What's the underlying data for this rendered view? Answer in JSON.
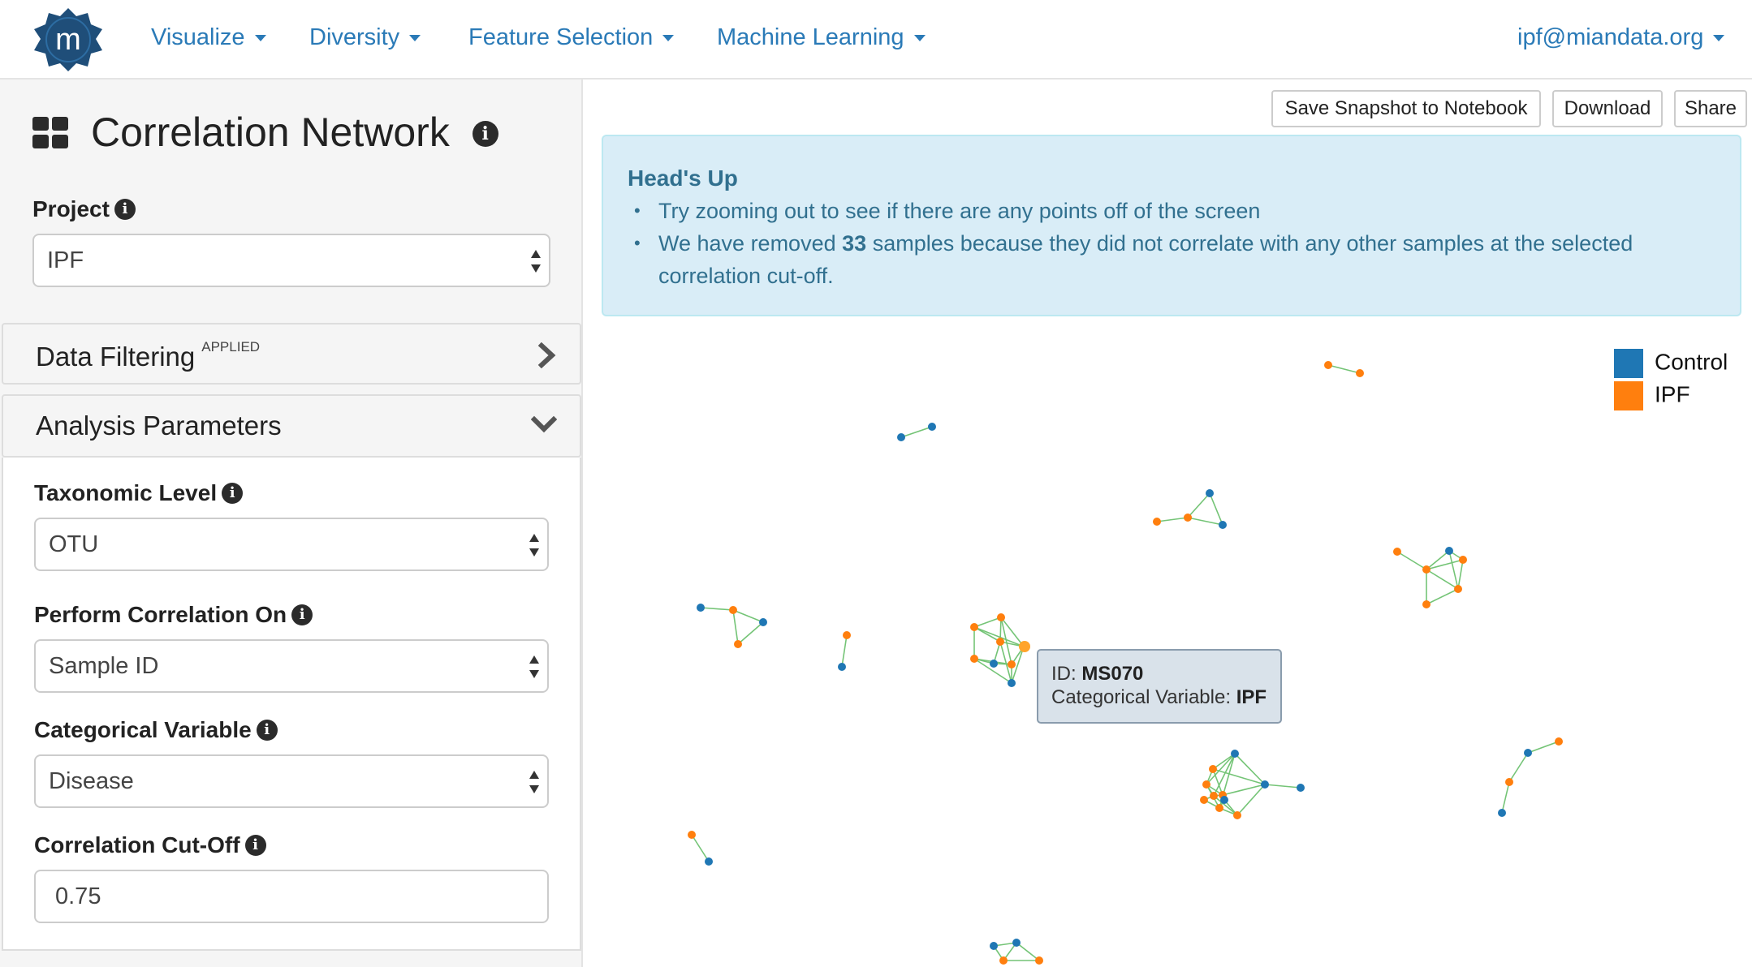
{
  "brand": {
    "logo_letter": "m",
    "logo_color": "#1f4e79"
  },
  "nav": {
    "items": [
      "Visualize",
      "Diversity",
      "Feature Selection",
      "Machine Learning"
    ],
    "user_email": "ipf@miandata.org"
  },
  "sidebar": {
    "page_title": "Correlation Network",
    "project": {
      "label": "Project",
      "value": "IPF"
    },
    "data_filtering": {
      "title": "Data Filtering",
      "badge": "APPLIED"
    },
    "analysis_parameters": {
      "title": "Analysis Parameters",
      "taxonomic_level": {
        "label": "Taxonomic Level",
        "value": "OTU"
      },
      "perform_correlation_on": {
        "label": "Perform Correlation On",
        "value": "Sample ID"
      },
      "categorical_variable": {
        "label": "Categorical Variable",
        "value": "Disease"
      },
      "correlation_cutoff": {
        "label": "Correlation Cut-Off",
        "value": "0.75"
      }
    }
  },
  "toolbar": {
    "save_snapshot_label": "Save Snapshot to Notebook",
    "download_label": "Download",
    "share_label": "Share"
  },
  "alert": {
    "heading": "Head's Up",
    "bullet_1": "Try zooming out to see if there are any points off of the screen",
    "bullet_2_prefix": "We have removed",
    "bullet_2_count": "33",
    "bullet_2_suffix": "samples because they did not correlate with any other samples at the selected correlation cut-off."
  },
  "legend": {
    "control_label": "Control",
    "ipf_label": "IPF",
    "control_color": "#1f77b4",
    "ipf_color": "#ff7f0e"
  },
  "tooltip": {
    "id_label": "ID:",
    "id_value": "MS070",
    "var_label": "Categorical Variable:",
    "var_value": "IPF"
  },
  "colors": {
    "link": "#2a7ab7",
    "edge": "#74c476",
    "alert_bg": "#d9edf7",
    "alert_text": "#31708f"
  }
}
